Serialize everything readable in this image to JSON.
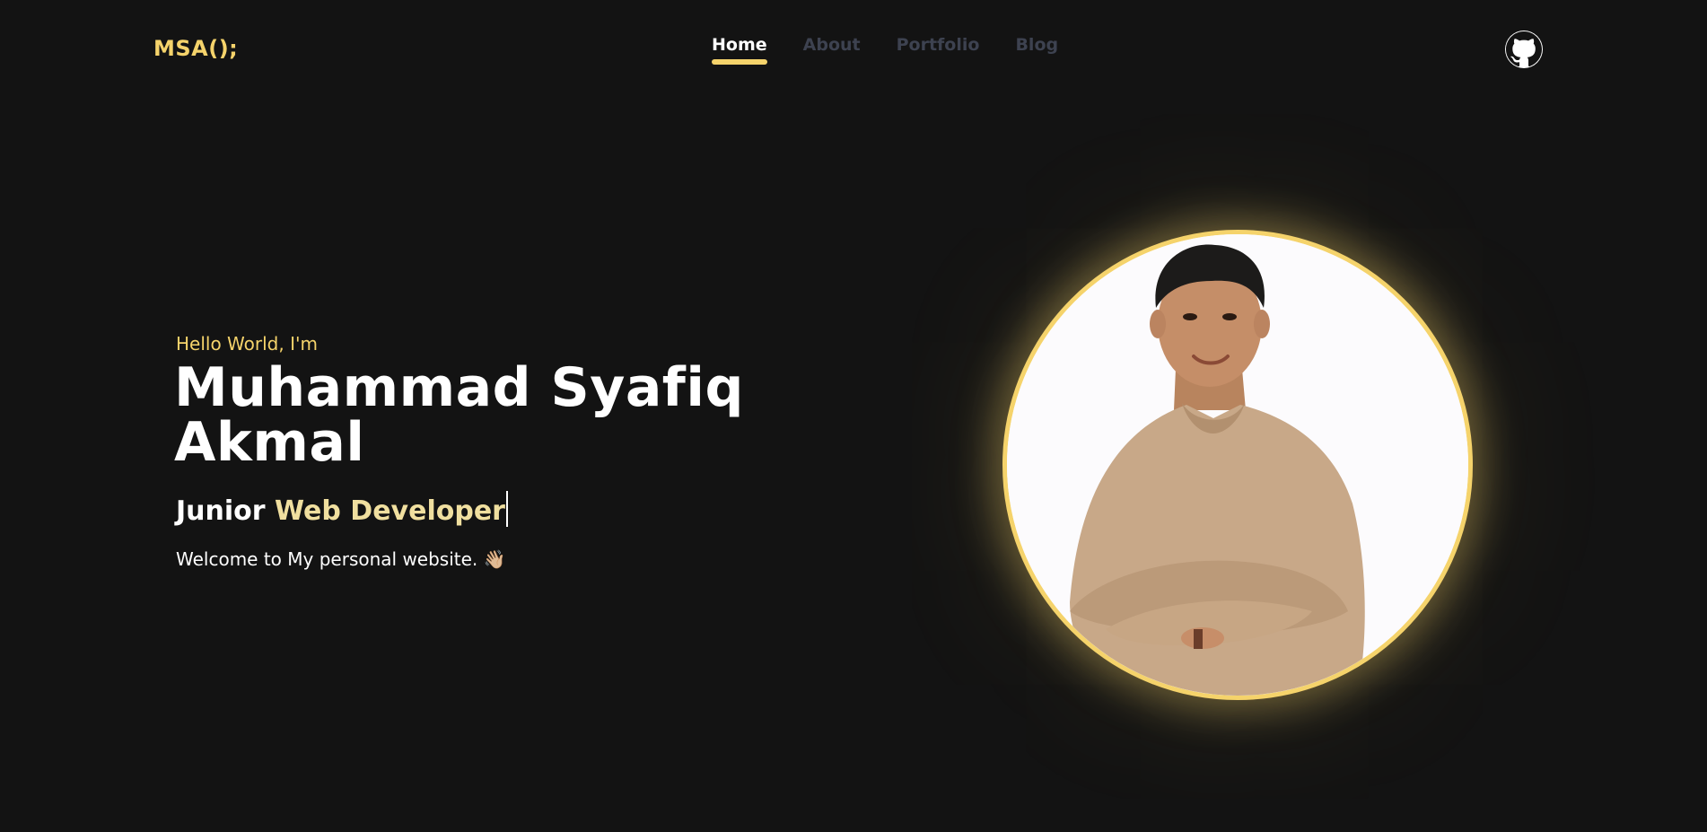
{
  "header": {
    "logo": "MSA();",
    "nav": [
      {
        "label": "Home",
        "active": true
      },
      {
        "label": "About",
        "active": false
      },
      {
        "label": "Portfolio",
        "active": false
      },
      {
        "label": "Blog",
        "active": false
      }
    ],
    "github_icon": "github-icon"
  },
  "hero": {
    "greeting": "Hello World, I'm",
    "name": "Muhammad Syafiq Akmal",
    "role_part1": "Junior ",
    "role_part2": "Web Developer",
    "welcome": "Welcome to My personal website.",
    "wave_emoji": "👋🏼"
  },
  "colors": {
    "background": "#131313",
    "accent": "#f5d36b",
    "role_accent": "#f0df9f",
    "nav_inactive": "#3d4250",
    "text": "#ffffff"
  }
}
